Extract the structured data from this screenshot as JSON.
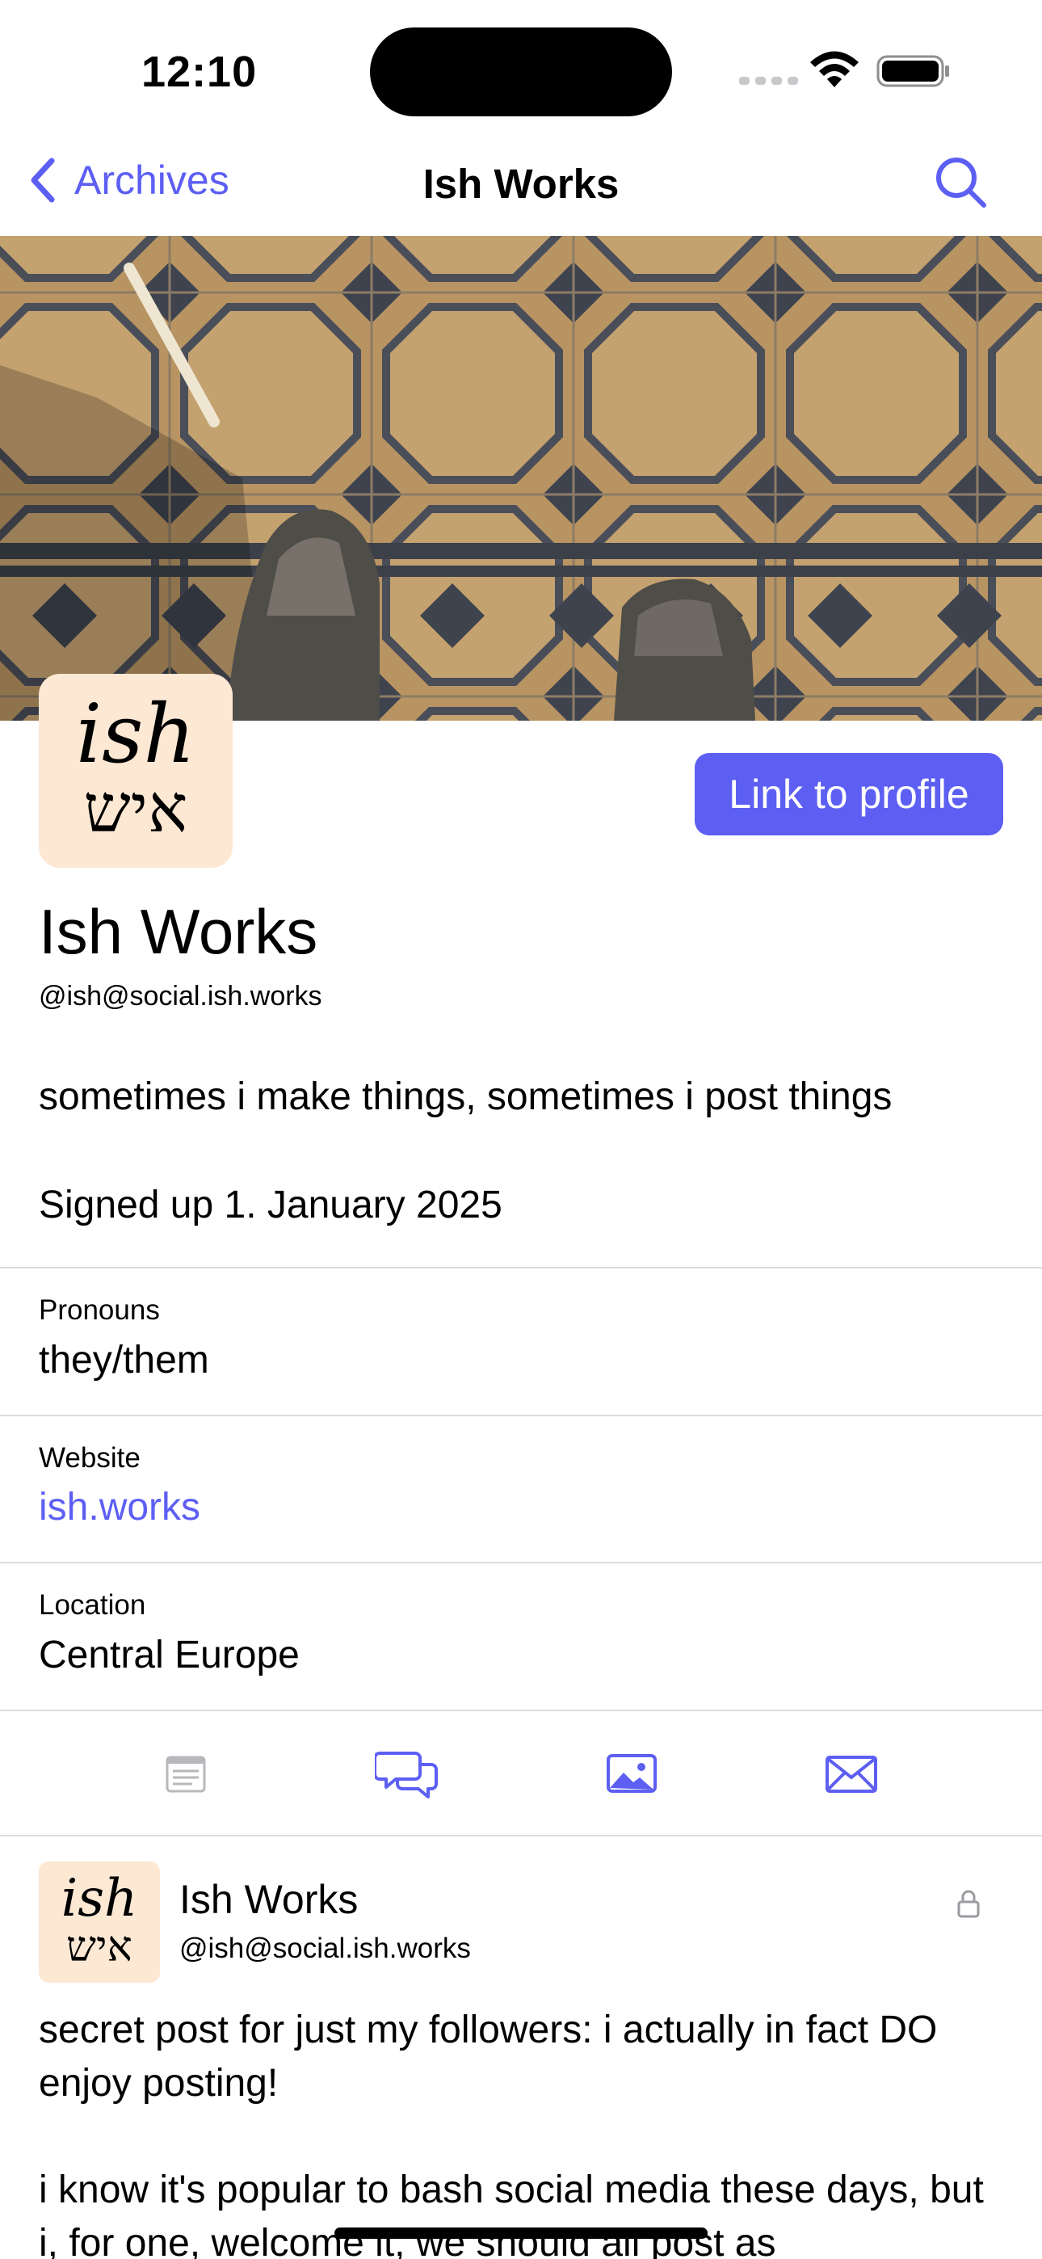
{
  "status_bar": {
    "time": "12:10"
  },
  "nav": {
    "back_label": "Archives",
    "title": "Ish Works"
  },
  "profile": {
    "avatar_line1": "ish",
    "avatar_line2": "איש",
    "link_button": "Link to profile",
    "display_name": "Ish Works",
    "handle": "@ish@social.ish.works",
    "bio": "sometimes i make things, sometimes i post things",
    "signed_up": "Signed up 1. January 2025"
  },
  "fields": [
    {
      "label": "Pronouns",
      "value": "they/them"
    },
    {
      "label": "Website",
      "value": "ish.works"
    },
    {
      "label": "Location",
      "value": "Central Europe"
    }
  ],
  "tabs": [
    {
      "icon": "posts-icon"
    },
    {
      "icon": "replies-icon"
    },
    {
      "icon": "media-icon"
    },
    {
      "icon": "mentions-icon"
    }
  ],
  "post": {
    "author_name": "Ish Works",
    "author_handle": "@ish@social.ish.works",
    "visibility_icon": "lock-icon",
    "paragraph1": "secret post for just my followers: i actually in fact DO enjoy posting!",
    "paragraph2": "i know it's popular to bash social media these days, but i, for one, welcome it, we should all post as"
  },
  "colors": {
    "accent": "#5d5ff3",
    "avatar_bg": "#fde8d4",
    "divider": "#dcdcde"
  }
}
